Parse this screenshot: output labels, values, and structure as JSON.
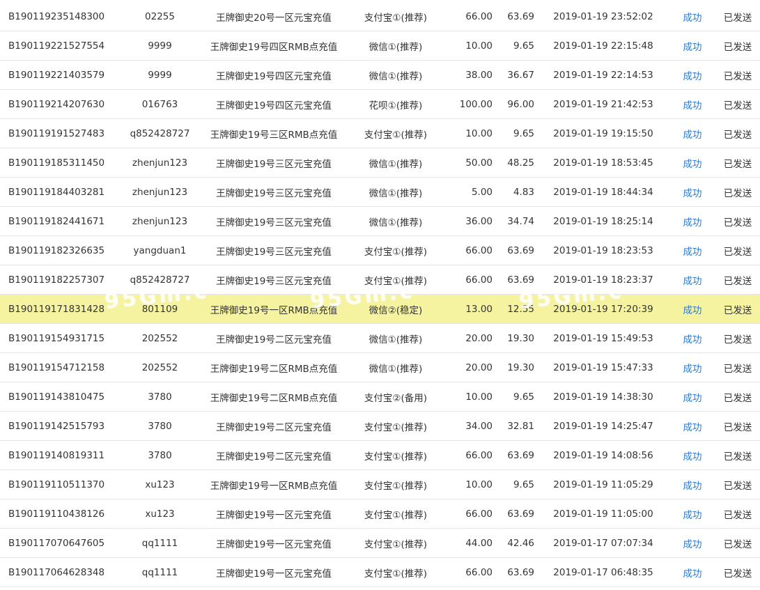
{
  "colors": {
    "status_link": "#2a78c9",
    "highlight_row": "#f5f3a0",
    "row_border": "#e4e4e4",
    "text": "#333333"
  },
  "highlighted_row_index": 10,
  "watermark_text": "95Gm.c",
  "rows": [
    {
      "order_id": "B190119235148300",
      "account": "02255",
      "product": "王牌御史20号一区元宝充值",
      "payment": "支付宝①(推荐)",
      "amount": "66.00",
      "paid": "63.69",
      "time": "2019-01-19 23:52:02",
      "status": "成功",
      "shipping": "已发送"
    },
    {
      "order_id": "B190119221527554",
      "account": "9999",
      "product": "王牌御史19号四区RMB点充值",
      "payment": "微信①(推荐)",
      "amount": "10.00",
      "paid": "9.65",
      "time": "2019-01-19 22:15:48",
      "status": "成功",
      "shipping": "已发送"
    },
    {
      "order_id": "B190119221403579",
      "account": "9999",
      "product": "王牌御史19号四区元宝充值",
      "payment": "微信①(推荐)",
      "amount": "38.00",
      "paid": "36.67",
      "time": "2019-01-19 22:14:53",
      "status": "成功",
      "shipping": "已发送"
    },
    {
      "order_id": "B190119214207630",
      "account": "016763",
      "product": "王牌御史19号四区元宝充值",
      "payment": "花呗①(推荐)",
      "amount": "100.00",
      "paid": "96.00",
      "time": "2019-01-19 21:42:53",
      "status": "成功",
      "shipping": "已发送"
    },
    {
      "order_id": "B190119191527483",
      "account": "q852428727",
      "product": "王牌御史19号三区RMB点充值",
      "payment": "支付宝①(推荐)",
      "amount": "10.00",
      "paid": "9.65",
      "time": "2019-01-19 19:15:50",
      "status": "成功",
      "shipping": "已发送"
    },
    {
      "order_id": "B190119185311450",
      "account": "zhenjun123",
      "product": "王牌御史19号三区元宝充值",
      "payment": "微信①(推荐)",
      "amount": "50.00",
      "paid": "48.25",
      "time": "2019-01-19 18:53:45",
      "status": "成功",
      "shipping": "已发送"
    },
    {
      "order_id": "B190119184403281",
      "account": "zhenjun123",
      "product": "王牌御史19号三区元宝充值",
      "payment": "微信①(推荐)",
      "amount": "5.00",
      "paid": "4.83",
      "time": "2019-01-19 18:44:34",
      "status": "成功",
      "shipping": "已发送"
    },
    {
      "order_id": "B190119182441671",
      "account": "zhenjun123",
      "product": "王牌御史19号三区元宝充值",
      "payment": "微信①(推荐)",
      "amount": "36.00",
      "paid": "34.74",
      "time": "2019-01-19 18:25:14",
      "status": "成功",
      "shipping": "已发送"
    },
    {
      "order_id": "B190119182326635",
      "account": "yangduan1",
      "product": "王牌御史19号三区元宝充值",
      "payment": "支付宝①(推荐)",
      "amount": "66.00",
      "paid": "63.69",
      "time": "2019-01-19 18:23:53",
      "status": "成功",
      "shipping": "已发送"
    },
    {
      "order_id": "B190119182257307",
      "account": "q852428727",
      "product": "王牌御史19号三区元宝充值",
      "payment": "支付宝①(推荐)",
      "amount": "66.00",
      "paid": "63.69",
      "time": "2019-01-19 18:23:37",
      "status": "成功",
      "shipping": "已发送"
    },
    {
      "order_id": "B190119171831428",
      "account": "801109",
      "product": "王牌御史19号一区RMB点充值",
      "payment": "微信②(稳定)",
      "amount": "13.00",
      "paid": "12.55",
      "time": "2019-01-19 17:20:39",
      "status": "成功",
      "shipping": "已发送"
    },
    {
      "order_id": "B190119154931715",
      "account": "202552",
      "product": "王牌御史19号二区元宝充值",
      "payment": "微信①(推荐)",
      "amount": "20.00",
      "paid": "19.30",
      "time": "2019-01-19 15:49:53",
      "status": "成功",
      "shipping": "已发送"
    },
    {
      "order_id": "B190119154712158",
      "account": "202552",
      "product": "王牌御史19号二区RMB点充值",
      "payment": "微信①(推荐)",
      "amount": "20.00",
      "paid": "19.30",
      "time": "2019-01-19 15:47:33",
      "status": "成功",
      "shipping": "已发送"
    },
    {
      "order_id": "B190119143810475",
      "account": "3780",
      "product": "王牌御史19号二区RMB点充值",
      "payment": "支付宝②(备用)",
      "amount": "10.00",
      "paid": "9.65",
      "time": "2019-01-19 14:38:30",
      "status": "成功",
      "shipping": "已发送"
    },
    {
      "order_id": "B190119142515793",
      "account": "3780",
      "product": "王牌御史19号二区元宝充值",
      "payment": "支付宝①(推荐)",
      "amount": "34.00",
      "paid": "32.81",
      "time": "2019-01-19 14:25:47",
      "status": "成功",
      "shipping": "已发送"
    },
    {
      "order_id": "B190119140819311",
      "account": "3780",
      "product": "王牌御史19号二区元宝充值",
      "payment": "支付宝①(推荐)",
      "amount": "66.00",
      "paid": "63.69",
      "time": "2019-01-19 14:08:56",
      "status": "成功",
      "shipping": "已发送"
    },
    {
      "order_id": "B190119110511370",
      "account": "xu123",
      "product": "王牌御史19号一区RMB点充值",
      "payment": "支付宝①(推荐)",
      "amount": "10.00",
      "paid": "9.65",
      "time": "2019-01-19 11:05:29",
      "status": "成功",
      "shipping": "已发送"
    },
    {
      "order_id": "B190119110438126",
      "account": "xu123",
      "product": "王牌御史19号一区元宝充值",
      "payment": "支付宝①(推荐)",
      "amount": "66.00",
      "paid": "63.69",
      "time": "2019-01-19 11:05:00",
      "status": "成功",
      "shipping": "已发送"
    },
    {
      "order_id": "B190117070647605",
      "account": "qq1111",
      "product": "王牌御史19号一区元宝充值",
      "payment": "支付宝①(推荐)",
      "amount": "44.00",
      "paid": "42.46",
      "time": "2019-01-17 07:07:34",
      "status": "成功",
      "shipping": "已发送"
    },
    {
      "order_id": "B190117064628348",
      "account": "qq1111",
      "product": "王牌御史19号一区元宝充值",
      "payment": "支付宝①(推荐)",
      "amount": "66.00",
      "paid": "63.69",
      "time": "2019-01-17 06:48:35",
      "status": "成功",
      "shipping": "已发送"
    }
  ]
}
